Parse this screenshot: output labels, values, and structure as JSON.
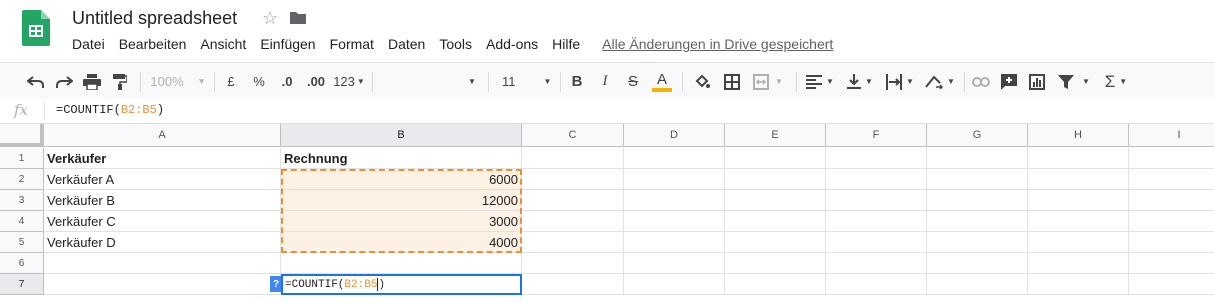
{
  "app": {
    "title": "Untitled spreadsheet",
    "menu": [
      "Datei",
      "Bearbeiten",
      "Ansicht",
      "Einfügen",
      "Format",
      "Daten",
      "Tools",
      "Add-ons",
      "Hilfe"
    ],
    "save_status": "Alle Änderungen in Drive gespeichert"
  },
  "toolbar": {
    "zoom": "100%",
    "currency": "£",
    "percent": "%",
    "decrease_decimals": ".0",
    "increase_decimals": ".00",
    "number_format": "123",
    "font_size": "11",
    "bold": "B",
    "italic": "I",
    "strike": "S",
    "text_color": "A",
    "text_color_value": "#f4b400",
    "sum": "Σ"
  },
  "formula_bar": {
    "fx": "fx",
    "prefix": "=COUNTIF(",
    "range": "B2:B5",
    "suffix": ")"
  },
  "sheet": {
    "columns": [
      "A",
      "B",
      "C",
      "D",
      "E",
      "F",
      "G",
      "H",
      "I"
    ],
    "active_column": "B",
    "rows": [
      "1",
      "2",
      "3",
      "4",
      "5",
      "6",
      "7"
    ],
    "active_row": "7",
    "cells": {
      "A1": "Verkäufer",
      "B1": "Rechnung",
      "A2": "Verkäufer A",
      "B2": "6000",
      "A3": "Verkäufer B",
      "B3": "12000",
      "A4": "Verkäufer C",
      "B4": "3000",
      "A5": "Verkäufer D",
      "B5": "4000"
    },
    "highlight_range": "B2:B5",
    "highlight_color": "#e69138",
    "editing_cell": "B7",
    "editor": {
      "prefix": "=COUNTIF(",
      "range": "B2:B5",
      "suffix": ")",
      "help": "?"
    }
  }
}
